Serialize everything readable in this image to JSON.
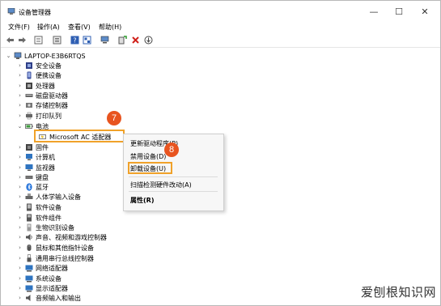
{
  "window": {
    "title": "设备管理器",
    "controls": [
      "—",
      "☐",
      "✕"
    ]
  },
  "menubar": [
    {
      "label": "文件(F)"
    },
    {
      "label": "操作(A)"
    },
    {
      "label": "查看(V)"
    },
    {
      "label": "帮助(H)"
    }
  ],
  "toolbar": [
    {
      "icon": "back-arrow-icon"
    },
    {
      "icon": "forward-arrow-icon"
    },
    {
      "icon": "properties-icon"
    },
    {
      "icon": "list-icon"
    },
    {
      "icon": "help-icon"
    },
    {
      "icon": "grid-icon"
    },
    {
      "icon": "monitor-icon"
    },
    {
      "icon": "add-driver-icon"
    },
    {
      "icon": "remove-icon"
    },
    {
      "icon": "download-icon"
    }
  ],
  "tree": {
    "root": "LAPTOP-E3B6RTQS",
    "items": [
      {
        "label": "安全设备",
        "icon": "security-icon",
        "color": "#2f3f87"
      },
      {
        "label": "便携设备",
        "icon": "portable-device-icon",
        "color": "#3b4f9c"
      },
      {
        "label": "处理器",
        "icon": "cpu-icon",
        "color": "#444444"
      },
      {
        "label": "磁盘驱动器",
        "icon": "disk-icon",
        "color": "#555555"
      },
      {
        "label": "存储控制器",
        "icon": "storage-icon",
        "color": "#555555"
      },
      {
        "label": "打印队列",
        "icon": "printer-icon",
        "color": "#555555"
      },
      {
        "label": "电池",
        "icon": "battery-icon",
        "color": "#3c9a3c",
        "expanded": true
      },
      {
        "label": "Microsoft AC 适配器",
        "icon": "ac-adapter-icon",
        "color": "#3c9a3c",
        "child": true
      },
      {
        "label": "固件",
        "icon": "firmware-icon",
        "color": "#444444"
      },
      {
        "label": "计算机",
        "icon": "computer-icon",
        "color": "#2f74c0"
      },
      {
        "label": "监视器",
        "icon": "monitor-icon",
        "color": "#2f74c0"
      },
      {
        "label": "键盘",
        "icon": "keyboard-icon",
        "color": "#555555"
      },
      {
        "label": "蓝牙",
        "icon": "bluetooth-icon",
        "color": "#1e6fd9"
      },
      {
        "label": "人体学输入设备",
        "icon": "hid-icon",
        "color": "#555555"
      },
      {
        "label": "软件设备",
        "icon": "software-device-icon",
        "color": "#555555"
      },
      {
        "label": "软件组件",
        "icon": "software-component-icon",
        "color": "#555555"
      },
      {
        "label": "生物识别设备",
        "icon": "biometric-icon",
        "color": "#555555"
      },
      {
        "label": "声音、视频和游戏控制器",
        "icon": "audio-icon",
        "color": "#555555"
      },
      {
        "label": "鼠标和其他指针设备",
        "icon": "mouse-icon",
        "color": "#555555"
      },
      {
        "label": "通用串行总线控制器",
        "icon": "usb-icon",
        "color": "#555555"
      },
      {
        "label": "网络适配器",
        "icon": "network-icon",
        "color": "#2f74c0"
      },
      {
        "label": "系统设备",
        "icon": "system-device-icon",
        "color": "#2f74c0"
      },
      {
        "label": "显示适配器",
        "icon": "display-adapter-icon",
        "color": "#2f74c0"
      },
      {
        "label": "音频输入和输出",
        "icon": "audio-io-icon",
        "color": "#555555"
      }
    ]
  },
  "context_menu": [
    {
      "label": "更新驱动程序(P)"
    },
    {
      "label": "禁用设备(D)"
    },
    {
      "label": "卸载设备(U)",
      "highlighted": true
    },
    {
      "label": "扫描检测硬件改动(A)"
    },
    {
      "label": "属性(R)",
      "bold": true
    }
  ],
  "steps": {
    "step1": "7",
    "step2": "8"
  },
  "accent_color": "#f0a22a",
  "badge_color": "#e8541f",
  "watermark": "爱刨根知识网"
}
